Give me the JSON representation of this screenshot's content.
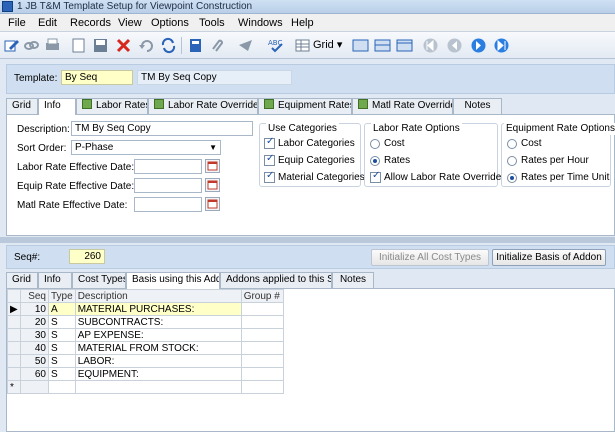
{
  "window": {
    "title": "1 JB T&M Template Setup for Viewpoint Construction"
  },
  "menu": [
    "File",
    "Edit",
    "Records",
    "View",
    "Options",
    "Tools",
    "Windows",
    "Help"
  ],
  "toolbar": {
    "grid_label": "Grid"
  },
  "header": {
    "template_label": "Template:",
    "template_value": "By Seq",
    "template_desc": "TM By Seq Copy"
  },
  "top_tabs": [
    {
      "label": "Grid"
    },
    {
      "label": "Info"
    },
    {
      "label": "Labor Rates"
    },
    {
      "label": "Labor Rate Overrides"
    },
    {
      "label": "Equipment Rates"
    },
    {
      "label": "Matl Rate Overrides"
    },
    {
      "label": "Notes"
    }
  ],
  "info": {
    "description_label": "Description:",
    "description_value": "TM By Seq Copy",
    "sort_order_label": "Sort Order:",
    "sort_order_value": "P-Phase",
    "labor_date_label": "Labor Rate Effective Date:",
    "equip_date_label": "Equip Rate Effective Date:",
    "matl_date_label": "Matl Rate Effective Date:"
  },
  "use_categories": {
    "title": "Use Categories",
    "items": [
      {
        "label": "Labor Categories",
        "checked": true
      },
      {
        "label": "Equip Categories",
        "checked": true
      },
      {
        "label": "Material Categories",
        "checked": true
      }
    ]
  },
  "labor_rate_options": {
    "title": "Labor Rate Options",
    "cost": "Cost",
    "rates": "Rates",
    "allow_overrides": "Allow Labor Rate Overrides",
    "selected": "rates",
    "allow_checked": true
  },
  "equipment_rate_options": {
    "title": "Equipment Rate Options",
    "options": [
      "Cost",
      "Rates per Hour",
      "Rates per Time Unit"
    ],
    "selected": "Rates per Time Unit"
  },
  "seq": {
    "label": "Seq#:",
    "value": "260",
    "init_all_button": "Initialize All Cost Types",
    "init_basis_button": "Initialize Basis of Addon"
  },
  "bottom_tabs": [
    {
      "label": "Grid"
    },
    {
      "label": "Info"
    },
    {
      "label": "Cost Types"
    },
    {
      "label": "Basis using this Addon"
    },
    {
      "label": "Addons applied to this Seq"
    },
    {
      "label": "Notes"
    }
  ],
  "grid": {
    "headers": [
      "Seq",
      "Type",
      "Description",
      "Group #"
    ],
    "rows": [
      {
        "seq": "10",
        "type": "A",
        "description": "MATERIAL PURCHASES:",
        "group": ""
      },
      {
        "seq": "20",
        "type": "S",
        "description": "SUBCONTRACTS:",
        "group": ""
      },
      {
        "seq": "30",
        "type": "S",
        "description": "AP EXPENSE:",
        "group": ""
      },
      {
        "seq": "40",
        "type": "S",
        "description": "MATERIAL FROM STOCK:",
        "group": ""
      },
      {
        "seq": "50",
        "type": "S",
        "description": "LABOR:",
        "group": ""
      },
      {
        "seq": "60",
        "type": "S",
        "description": "EQUIPMENT:",
        "group": ""
      }
    ],
    "new_row_marker": "*"
  }
}
